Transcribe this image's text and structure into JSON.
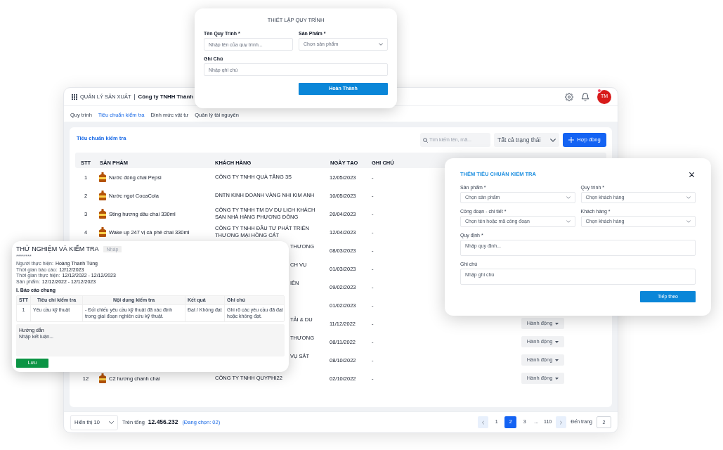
{
  "process_dialog": {
    "title": "THIẾT LẬP QUY TRÌNH",
    "rows": [
      [
        {
          "kind": "input",
          "label": "Tên Quy Trình *",
          "placeholder": "Nhập tên của quy trình..."
        },
        {
          "kind": "select",
          "label": "Sản Phẩm *",
          "placeholder": "Chọn sản phẩm"
        }
      ],
      [
        {
          "kind": "input",
          "label": "Ghi Chú",
          "placeholder": "Nhập ghi chú"
        }
      ]
    ],
    "submit": "Hoàn Thành"
  },
  "app": {
    "header": {
      "module": "QUẢN LÝ SẢN XUẤT",
      "company": "Công ty TNHH Thành",
      "avatar": {
        "initials": "TM",
        "badge": true
      }
    },
    "tabs": [
      {
        "label": "Quy trình",
        "selected": false
      },
      {
        "label": "Tiêu chuẩn kiểm tra",
        "selected": true
      },
      {
        "label": "Định mức vật tư",
        "selected": false
      },
      {
        "label": "Quản lý tài nguyên",
        "selected": false
      }
    ],
    "panel": {
      "title": "Tiêu chuẩn kiểm tra",
      "search": {
        "placeholder": "Tìm kiếm tên, mã..."
      },
      "status_filter": "Tất cả trạng thái",
      "add_button": "Hợp đồng"
    },
    "table": {
      "columns": [
        "STT",
        "SẢN PHẨM",
        "KHÁCH HÀNG",
        "NGÀY TẠO",
        "GHI CHÚ"
      ],
      "rows": [
        {
          "stt": "1",
          "product": "Nước đóng chai Pepsi",
          "customer": "CÔNG TY TNHH QUÀ TẶNG 3S",
          "date": "12/05/2023",
          "note": "-"
        },
        {
          "stt": "2",
          "product": "Nước ngọt CocaCola",
          "customer": "DNTN KINH DOANH VÀNG NHI KIM ANH",
          "date": "10/05/2023",
          "note": "-"
        },
        {
          "stt": "3",
          "product": "Sting hương dâu chai 330ml",
          "customer": "CÔNG TY TNHH TM DV DU LỊCH KHÁCH SẠN NHÀ HÀNG PHƯƠNG ĐÔNG",
          "date": "20/04/2023",
          "note": "-"
        },
        {
          "stt": "4",
          "product": "Wake up 247 vị cà phê chai 330ml",
          "customer": "CÔNG TY TNHH ĐẦU TƯ PHÁT TRIỂN THƯƠNG MẠI HỒNG CÁT",
          "date": "12/04/2023",
          "note": "-"
        },
        {
          "customer": "THƯƠNG",
          "date": "08/03/2023",
          "note": "-"
        },
        {
          "customer": "CH VỤ",
          "date": "01/03/2023",
          "note": "-"
        },
        {
          "customer": "IÊN",
          "date": "09/02/2023",
          "note": "-"
        },
        {
          "date": "01/02/2023",
          "note": "-"
        },
        {
          "customer": "TẢI & DU",
          "date": "11/12/2022",
          "note": "-",
          "action": "Hành động"
        },
        {
          "customer": "THƯƠNG",
          "date": "08/11/2022",
          "note": "-",
          "action": "Hành động"
        },
        {
          "customer": "VỤ SẮT",
          "date": "08/10/2022",
          "note": "-",
          "action": "Hành động"
        },
        {
          "stt": "12",
          "product": "C2 hương chanh chai",
          "customer": "CÔNG TY TNHH QUYPHI22",
          "date": "02/10/2022",
          "note": "-",
          "action": "Hành động"
        }
      ]
    },
    "footer": {
      "page_size": "Hiển thị 10",
      "total_label": "Trên tổng",
      "total": "12.456.232",
      "selection": "(Đang chọn: 02)",
      "pages": [
        {
          "kind": "page",
          "label": "1",
          "selected": false
        },
        {
          "kind": "page",
          "label": "2",
          "selected": true
        },
        {
          "kind": "page",
          "label": "3",
          "selected": false
        },
        {
          "kind": "ellipsis",
          "label": "...",
          "selected": false
        },
        {
          "kind": "page",
          "label": "110",
          "selected": false
        }
      ],
      "goto_label": "Đến trang",
      "goto_value": "2"
    }
  },
  "report_card": {
    "title": "THỬ NGHIỆM VÀ KIỂM TRA",
    "status": "Nháp",
    "code": "********",
    "info": [
      {
        "label": "Người thực hiện:",
        "value": "Hoàng Thanh Tùng"
      },
      {
        "label": "Thời gian báo cáo:",
        "value": "12/12/2023"
      },
      {
        "label": "Thời gian thực hiện:",
        "value": "12/12/2022 - 12/12/2023"
      },
      {
        "label": "Sản phẩm:",
        "value": "12/12/2022 - 12/12/2023"
      }
    ],
    "section": "I. Báo cáo chung",
    "table": {
      "columns": [
        "STT",
        "Tiêu chí kiểm tra",
        "Nội dung kiểm tra",
        "Kết quả",
        "Ghi chú"
      ],
      "rows": [
        [
          "1",
          "Yêu cầu kỹ thuật",
          "- Đối chiếu yêu cầu kỹ thuật đã xác định trong giai đoạn nghiên cứu kỹ thuật.",
          "Đạt / Không đạt",
          "Ghi rõ các yêu cầu đã đạt hoặc không đạt."
        ]
      ]
    },
    "conclusion": {
      "label": "Hướng dẫn",
      "placeholder": "Nhập kết luận..."
    },
    "save": "Lưu"
  },
  "standard_dialog": {
    "title": "THÊM TIÊU CHUẨN KIỂM TRA",
    "rows": [
      [
        {
          "kind": "select",
          "label": "Sản phẩm *",
          "placeholder": "Chọn sản phẩm"
        },
        {
          "kind": "select",
          "label": "Quy trình *",
          "placeholder": "Chọn khách hàng"
        }
      ],
      [
        {
          "kind": "select",
          "label": "Công đoạn - chi tiết *",
          "placeholder": "Chọn tên hoặc mã công đoạn"
        },
        {
          "kind": "select",
          "label": "Khách hàng *",
          "placeholder": "Chọn khách hàng"
        }
      ],
      [
        {
          "kind": "textarea",
          "label": "Quy định *",
          "placeholder": "Nhập quy định..."
        }
      ],
      [
        {
          "kind": "textarea",
          "label": "Ghi chú",
          "placeholder": "Nhập ghi chú"
        }
      ]
    ],
    "submit": "Tiếp theo"
  }
}
